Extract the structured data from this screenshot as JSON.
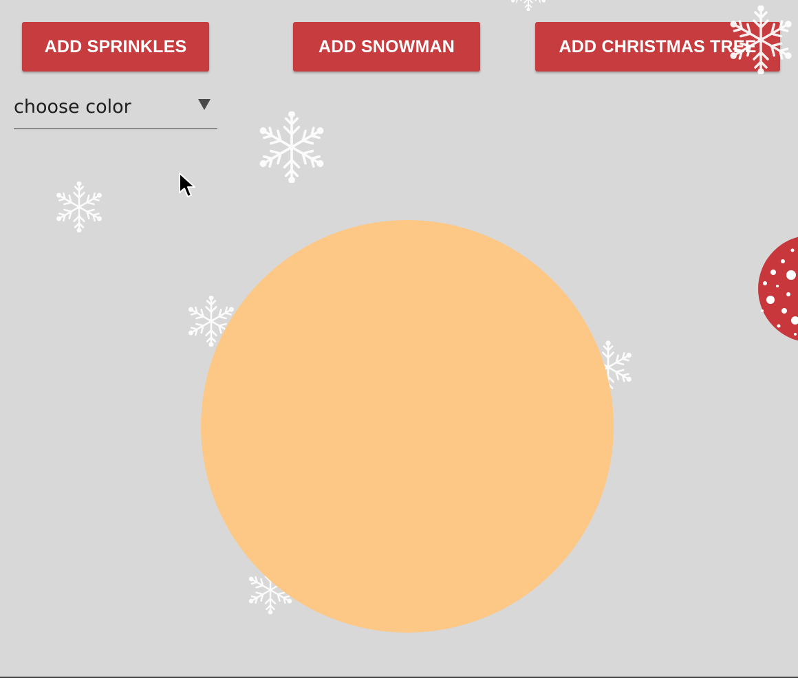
{
  "toolbar": {
    "add_sprinkles_label": "ADD SPRINKLES",
    "add_snowman_label": "ADD SNOWMAN",
    "add_tree_label": "ADD CHRISTMAS TREE",
    "button_color": "#c73c3e"
  },
  "color_select": {
    "placeholder": "choose color",
    "icon": "triangle-down-icon"
  },
  "canvas": {
    "background_color": "#d8d8d8",
    "snowball_color": "#fdc886",
    "ornament_color": "#c7373c",
    "decorations": [
      "snowflake-icon",
      "ornament-ball"
    ]
  },
  "pointer": {
    "icon": "arrow-cursor-icon"
  }
}
